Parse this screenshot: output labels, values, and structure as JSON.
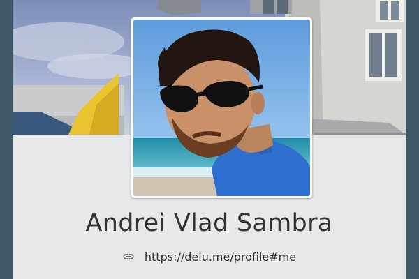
{
  "profile": {
    "name": "Andrei Vlad Sambra",
    "url": "https://deiu.me/profile#me"
  },
  "icons": {
    "link": "link-icon"
  },
  "colors": {
    "page_background": "#3f5966",
    "card_background": "#e6e8ea",
    "text": "#333333"
  }
}
